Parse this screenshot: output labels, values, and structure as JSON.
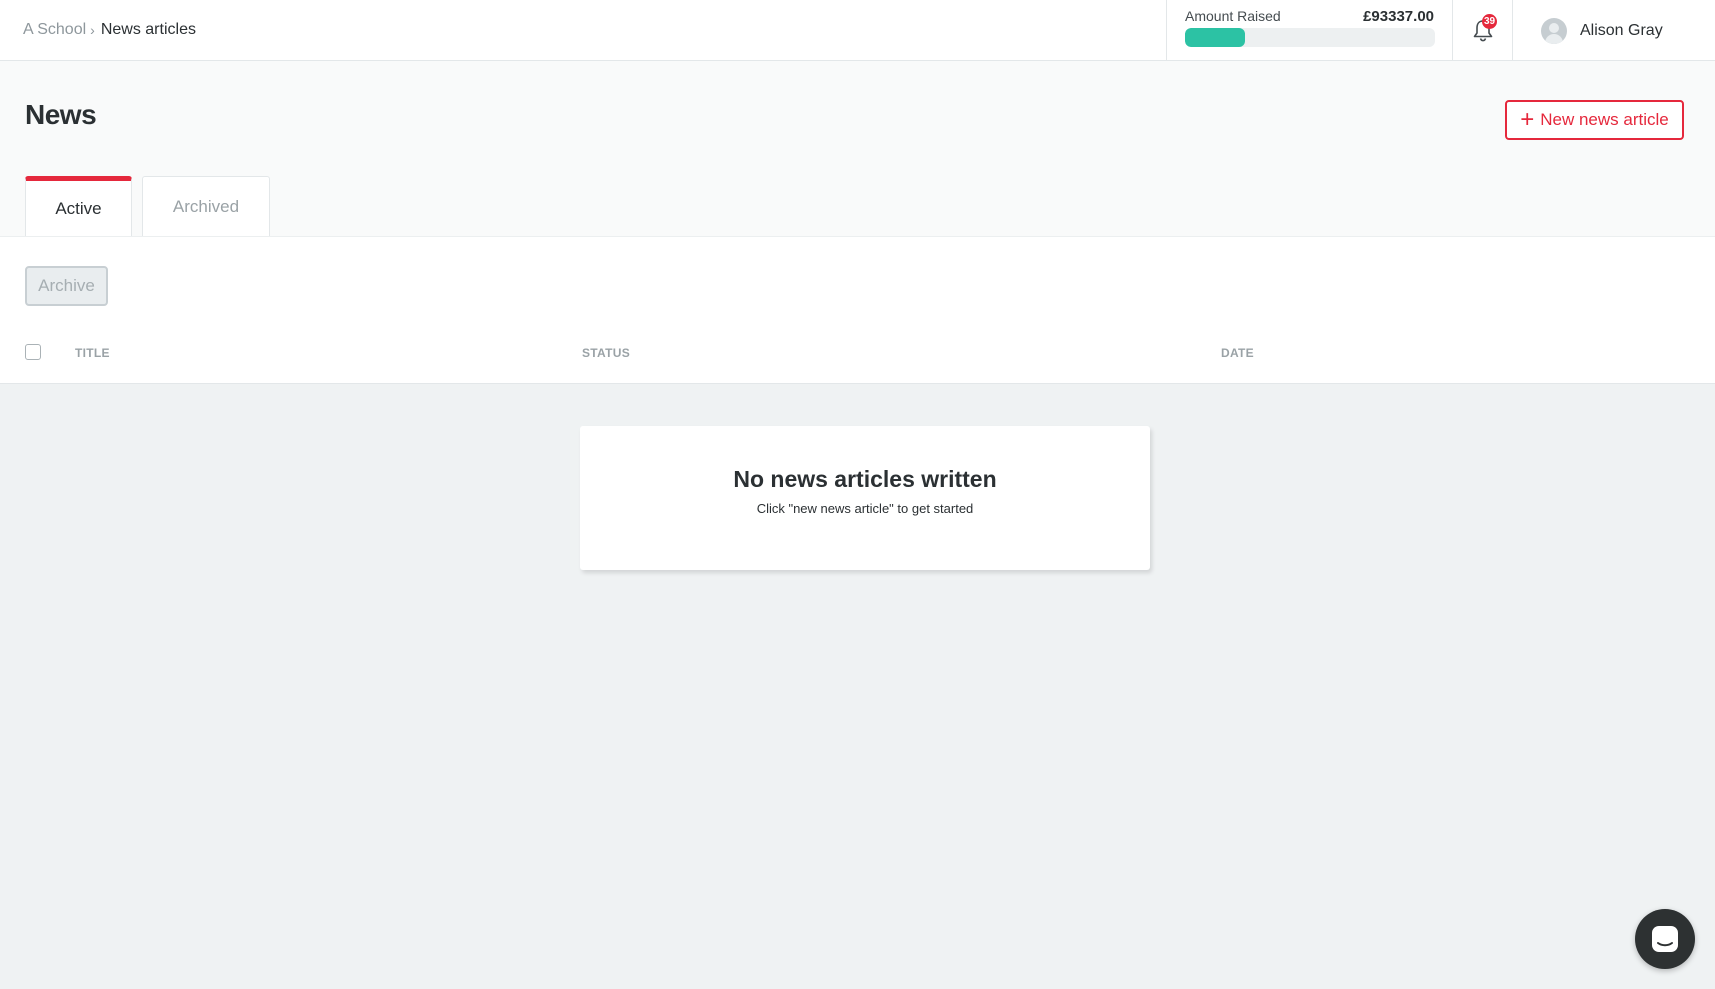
{
  "breadcrumb": {
    "root": "A School",
    "separator": "›",
    "current": "News articles"
  },
  "fundraising": {
    "label": "Amount Raised",
    "amount": "£93337.00",
    "progress_percent": 24,
    "bar_color": "#2cc2a4"
  },
  "notifications": {
    "count": "39",
    "icon": "bell-icon"
  },
  "user": {
    "name": "Alison Gray",
    "icon": "avatar-icon"
  },
  "page": {
    "title": "News",
    "new_button_label": "New news article"
  },
  "tabs": [
    {
      "label": "Active",
      "active": true
    },
    {
      "label": "Archived",
      "active": false
    }
  ],
  "toolbar": {
    "archive_label": "Archive"
  },
  "table": {
    "columns": [
      "TITLE",
      "STATUS",
      "DATE"
    ]
  },
  "empty_state": {
    "title": "No news articles written",
    "subtitle": "Click \"new news article\" to get started"
  },
  "colors": {
    "accent": "#e5283c",
    "background": "#eff2f3"
  },
  "chat": {
    "icon": "chat-icon"
  }
}
